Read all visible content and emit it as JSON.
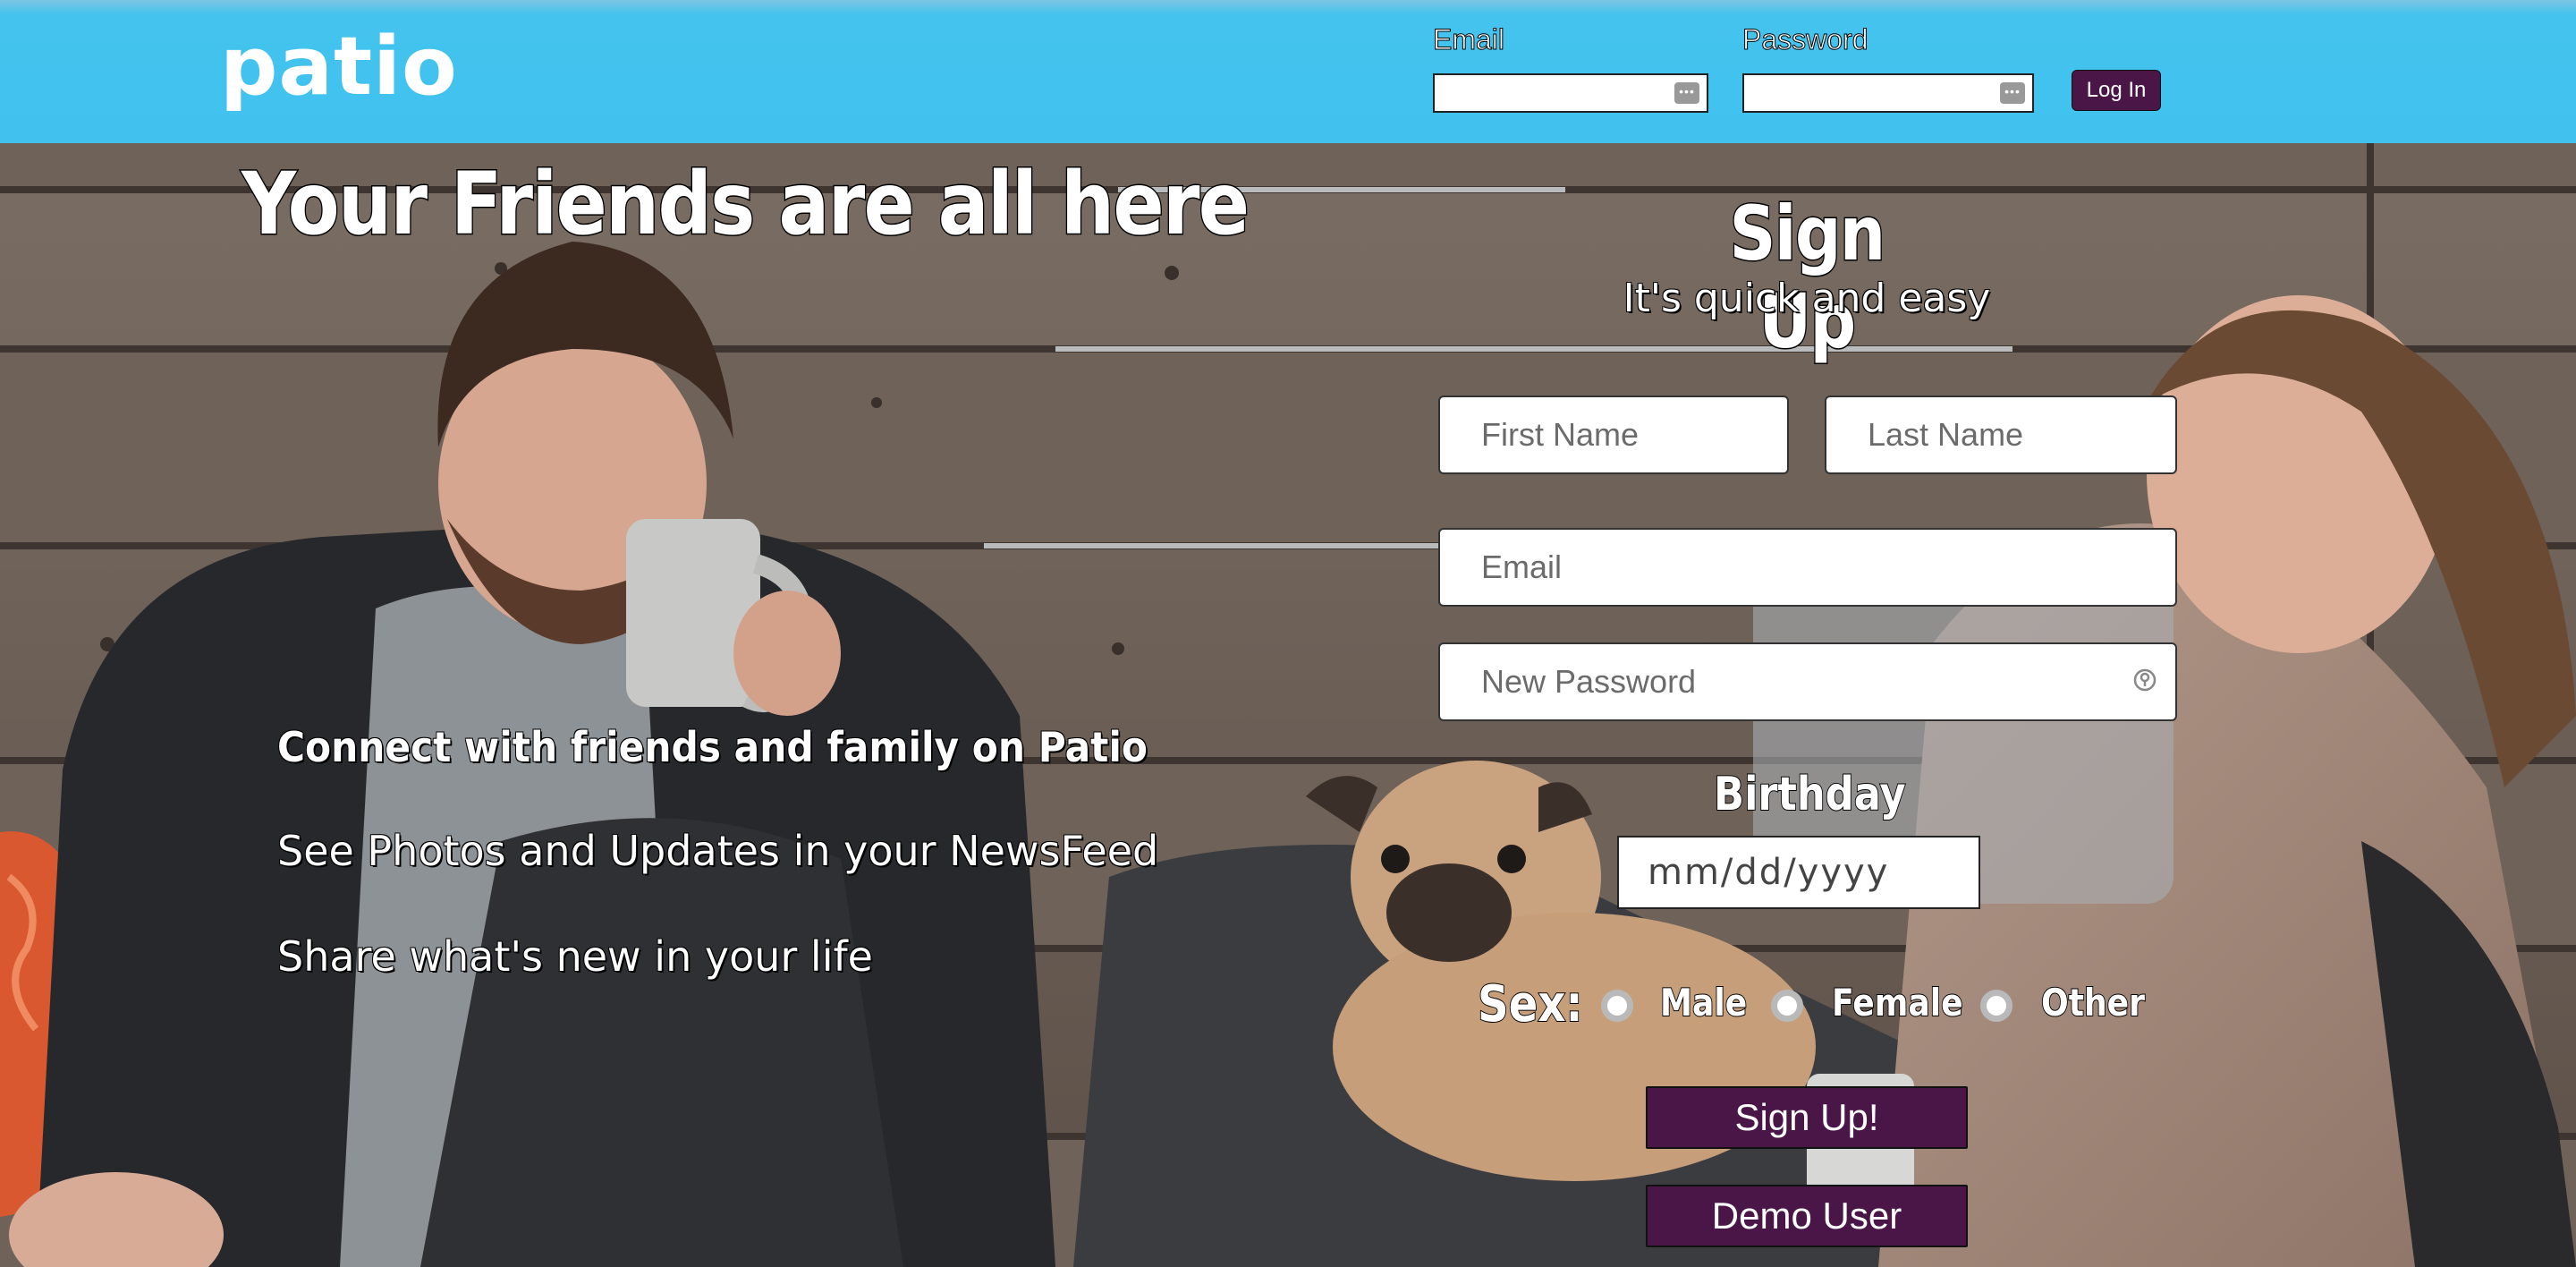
{
  "header": {
    "logo": "patio",
    "email_label": "Email",
    "password_label": "Password",
    "login_button": "Log In"
  },
  "hero": {
    "headline": "Your Friends are all here",
    "features": [
      "Connect with friends and family on Patio",
      "See Photos and Updates in your NewsFeed",
      "Share what's new in your life"
    ]
  },
  "signup": {
    "title": "Sign Up",
    "subtitle": "It's quick and easy",
    "first_name_placeholder": "First Name",
    "last_name_placeholder": "Last Name",
    "email_placeholder": "Email",
    "password_placeholder": "New Password",
    "birthday_label": "Birthday",
    "birthday_placeholder": "mm/dd/yyyy",
    "sex_label": "Sex:",
    "sex_options": [
      "Male",
      "Female",
      "Other"
    ],
    "signup_button": "Sign Up!",
    "demo_button": "Demo User"
  },
  "colors": {
    "header_bg": "#41c2ee",
    "button_purple": "#4a1647"
  },
  "icons": {
    "password_manager": "password-dots-icon",
    "password_key": "key-icon"
  }
}
